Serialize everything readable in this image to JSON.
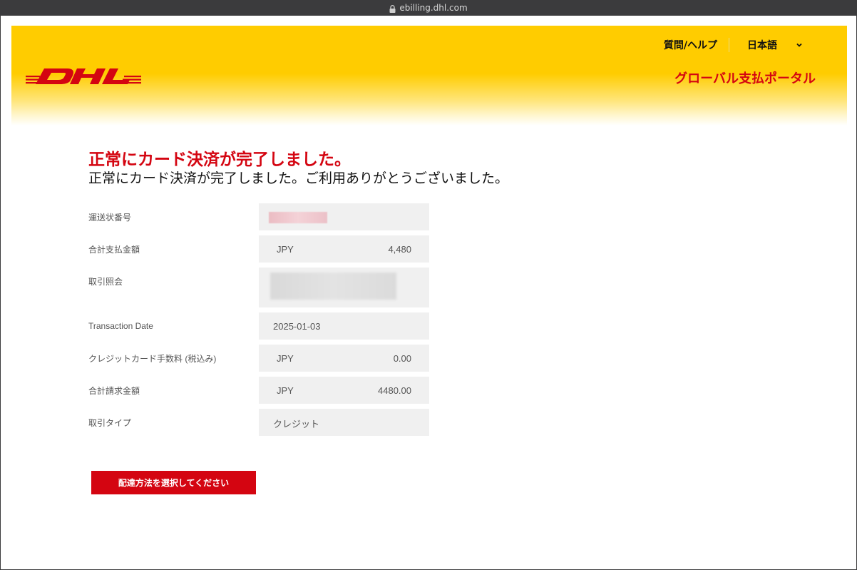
{
  "browser": {
    "url": "ebilling.dhl.com"
  },
  "header": {
    "logo_icon": "dhl-logo-icon",
    "help_link": "質問/ヘルプ",
    "language": "日本語",
    "portal_title": "グローバル支払ポータル"
  },
  "main": {
    "title": "正常にカード決済が完了しました。",
    "subtitle": "正常にカード決済が完了しました。ご利用ありがとうございました。",
    "fields": {
      "waybill": {
        "label": "運送状番号"
      },
      "total_paid": {
        "label": "合計支払金額",
        "currency": "JPY",
        "amount": "4,480"
      },
      "reference": {
        "label": "取引照会"
      },
      "date": {
        "label": "Transaction Date",
        "value": "2025-01-03"
      },
      "card_fee": {
        "label": "クレジットカード手数料 (税込み)",
        "currency": "JPY",
        "amount": "0.00"
      },
      "total_billed": {
        "label": "合計請求金額",
        "currency": "JPY",
        "amount": "4480.00"
      },
      "type": {
        "label": "取引タイプ",
        "value": "クレジット"
      }
    },
    "action_button": "配達方法を選択してください"
  },
  "colors": {
    "brand_yellow": "#ffcc00",
    "brand_red": "#d40511",
    "field_bg": "#f0f0f0"
  }
}
